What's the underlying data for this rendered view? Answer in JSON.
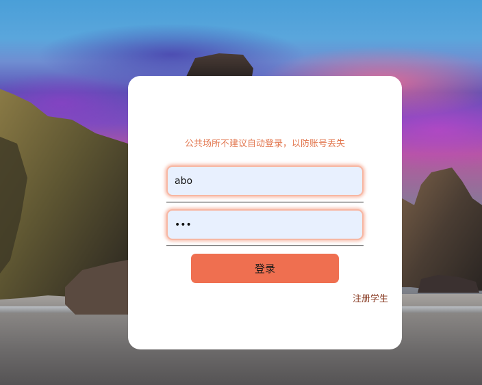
{
  "login": {
    "notice": "公共场所不建议自动登录，以防账号丢失",
    "username_value": "abo",
    "password_value": "abc",
    "submit_label": "登录",
    "register_label": "注册学生"
  },
  "colors": {
    "notice_text": "#e2774f",
    "button_bg": "#ef6f50",
    "register_text": "#8a3d25",
    "input_bg": "#e8f0fe",
    "input_glow": "#f28c6e",
    "card_bg": "#ffffff"
  }
}
